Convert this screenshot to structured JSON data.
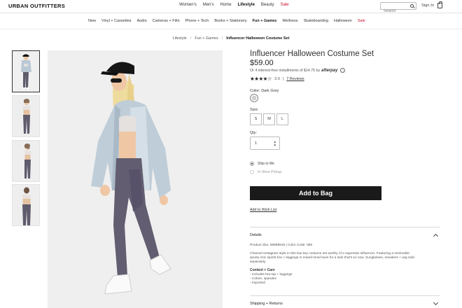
{
  "header": {
    "logo": "URBAN OUTFITTERS",
    "nav": [
      "Women's",
      "Men's",
      "Home",
      "Lifestyle",
      "Beauty",
      "Sale"
    ],
    "search_placeholder": "Search",
    "sign_in": "Sign In"
  },
  "categories": [
    "New",
    "Vinyl + Cassettes",
    "Audio",
    "Cameras + Film",
    "Phone + Tech",
    "Books + Stationery",
    "Fun + Games",
    "Wellness",
    "Skateboarding",
    "Halloween",
    "Sale"
  ],
  "breadcrumb": [
    "Lifestyle",
    "Fun + Games",
    "Influencer Halloween Costume Set"
  ],
  "product": {
    "title": "Influencer Halloween Costume Set",
    "price": "$59.00",
    "installments": "Or 4 interest-free installments of $14.75 by",
    "afterpay": "afterpay",
    "rating": "3.9",
    "stars": "★★★★☆",
    "reviews": "7 Reviews",
    "color_label": "Color: Dark Grey",
    "size_label": "Size:",
    "sizes": [
      "S",
      "M",
      "L"
    ],
    "qty_label": "Qty:",
    "qty_value": "1",
    "ship_option": "Ship to Me",
    "pickup_option": "In-Store Pickup",
    "add_to_bag": "Add to Bag",
    "wishlist": "Add to Wish List"
  },
  "details": {
    "heading": "Details",
    "product_sku": "Product Sku: 56889645 | Color Code: 065",
    "description": [
      "Channel Instagram style in this low key costume set worthy of a superstar influencer. Featuring a minimalist",
      "sporty-chic sports bra + leggings in muted tonal hues for a look that's so now. Sunglasses, sneakers + wig sold",
      "separately."
    ],
    "care_heading": "Content + Care",
    "care_items": [
      "- Includes bra top + leggings",
      "- Cotton, spandex",
      "- Imported"
    ]
  },
  "shipping": {
    "heading": "Shipping + Returns"
  },
  "colors": {
    "sale_red": "#c8102e",
    "button_bg": "#1a1a1a"
  }
}
